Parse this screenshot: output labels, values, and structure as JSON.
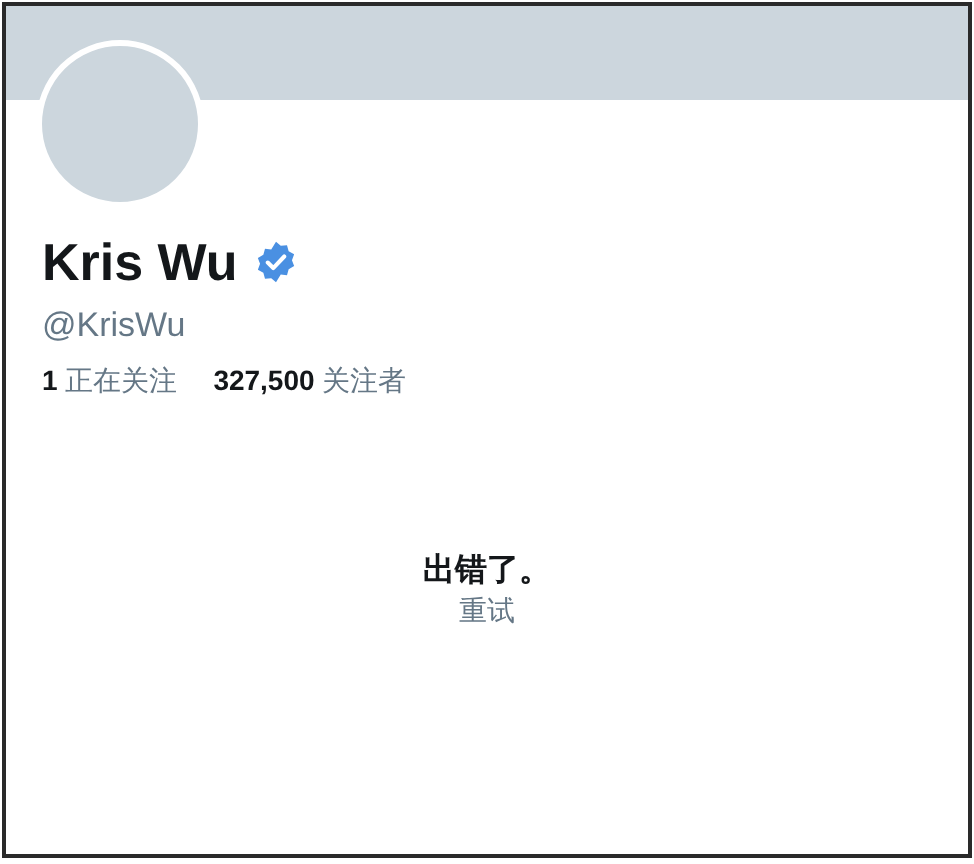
{
  "profile": {
    "name": "Kris Wu",
    "verified": true,
    "handle": "@KrisWu"
  },
  "stats": [
    {
      "count": "1",
      "label": "正在关注"
    },
    {
      "count": "327,500",
      "label": "关注者"
    }
  ],
  "error": {
    "message": "出错了。",
    "retry": "重试"
  }
}
